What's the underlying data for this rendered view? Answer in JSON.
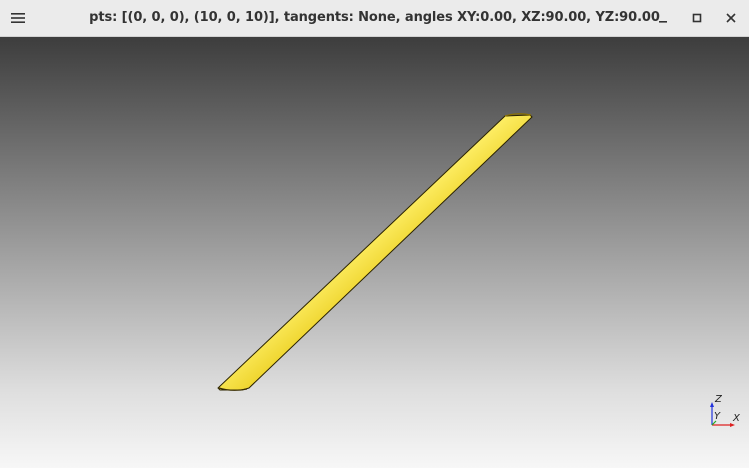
{
  "window": {
    "title": "pts: [(0, 0, 0), (10, 0, 10)], tangents: None, angles XY:0.00, XZ:90.00, YZ:90.00"
  },
  "titlebar_icons": {
    "menu": "hamburger-menu-icon",
    "minimize": "minimize-icon",
    "maximize": "maximize-icon",
    "close": "close-icon"
  },
  "axes": {
    "z_label": "Z",
    "y_label": "Y",
    "x_label": "X",
    "z_color": "#2233dd",
    "y_color": "#22aa22",
    "x_color": "#dd2222"
  },
  "shape": {
    "color": "#e8c400",
    "highlight": "#fff27a",
    "shadow": "#5a4700"
  }
}
